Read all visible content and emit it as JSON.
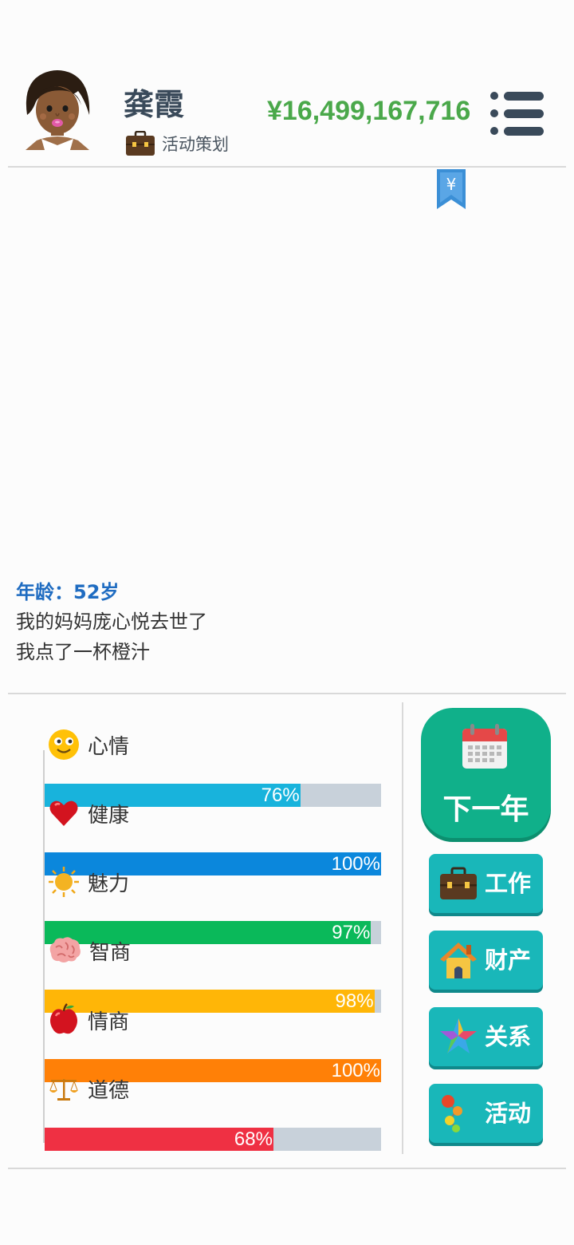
{
  "header": {
    "name": "龚霞",
    "job": "活动策划",
    "money": "¥16,499,167,716"
  },
  "bookmark_symbol": "¥",
  "log": {
    "age": "年龄：52岁",
    "lines": [
      "我的妈妈庞心悦去世了",
      "我点了一杯橙汁"
    ]
  },
  "stats": [
    {
      "label": "心情",
      "icon": "smiley-face-icon",
      "value": 76,
      "pct": "76%",
      "color": "#18b3dc"
    },
    {
      "label": "健康",
      "icon": "heart-icon",
      "value": 100,
      "pct": "100%",
      "color": "#0b87dc"
    },
    {
      "label": "魅力",
      "icon": "sun-icon",
      "value": 97,
      "pct": "97%",
      "color": "#0ab95a"
    },
    {
      "label": "智商",
      "icon": "brain-icon",
      "value": 98,
      "pct": "98%",
      "color": "#ffb607"
    },
    {
      "label": "情商",
      "icon": "apple-icon",
      "value": 100,
      "pct": "100%",
      "color": "#ff8007"
    },
    {
      "label": "道德",
      "icon": "scales-icon",
      "value": 68,
      "pct": "68%",
      "color": "#ef3043"
    }
  ],
  "buttons": {
    "next_year": "下一年",
    "work": "工作",
    "assets": "财产",
    "relations": "关系",
    "activities": "活动"
  },
  "colors": {
    "money_green": "#4aa84a",
    "age_blue": "#1f6cc1",
    "next_year_green": "#10b08a",
    "action_teal": "#19b7b9"
  }
}
